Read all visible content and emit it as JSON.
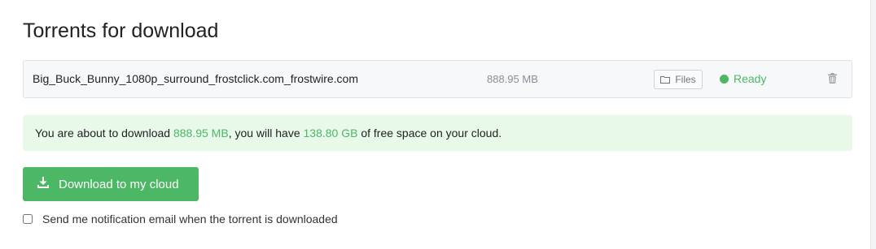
{
  "page": {
    "title": "Torrents for download"
  },
  "torrent": {
    "name": "Big_Buck_Bunny_1080p_surround_frostclick.com_frostwire.com",
    "size": "888.95 MB",
    "files_label": "Files",
    "status": "Ready",
    "status_color": "#4cb866"
  },
  "info": {
    "prefix": "You are about to download ",
    "download_size": "888.95 MB",
    "middle": ", you will have ",
    "free_space": "138.80 GB",
    "suffix": " of free space on your cloud."
  },
  "actions": {
    "download_label": "Download to my cloud",
    "notify_label": "Send me notification email when the torrent is downloaded",
    "notify_checked": false
  },
  "icons": {
    "files": "folder-icon",
    "status": "status-dot-icon",
    "delete": "trash-icon",
    "download": "download-icon"
  },
  "colors": {
    "accent": "#4cb866",
    "info_bg": "#e8f9ea"
  }
}
